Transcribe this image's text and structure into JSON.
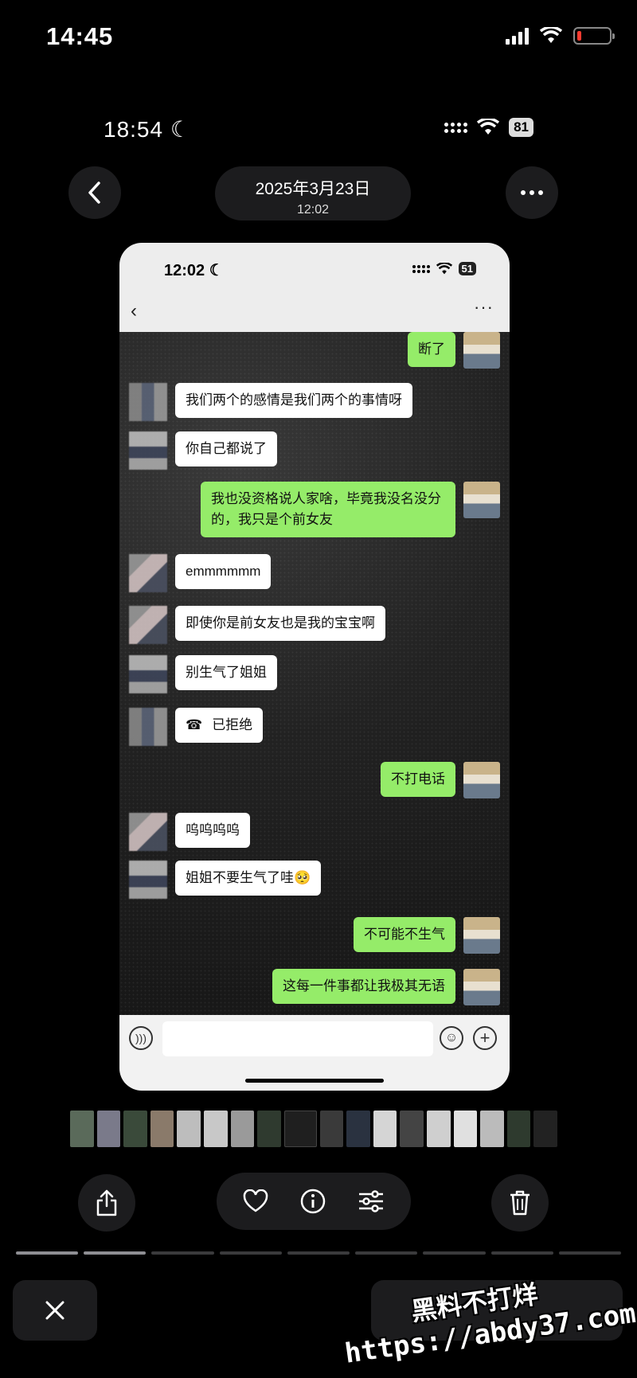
{
  "outer_status": {
    "time": "14:45"
  },
  "viewer": {
    "status_time": "18:54",
    "battery": "81",
    "date": "2025年3月23日",
    "time": "12:02"
  },
  "inner_screen": {
    "time": "12:02",
    "battery": "51",
    "back": "‹",
    "more": "···",
    "messages": [
      {
        "side": "right",
        "text": "断了"
      },
      {
        "side": "left",
        "text": "我们两个的感情是我们两个的事情呀"
      },
      {
        "side": "left",
        "text": "你自己都说了"
      },
      {
        "side": "right",
        "text": "我也没资格说人家啥，毕竟我没名没分的，我只是个前女友"
      },
      {
        "side": "left",
        "text": "emmmmmm"
      },
      {
        "side": "left",
        "text": "即使你是前女友也是我的宝宝啊"
      },
      {
        "side": "left",
        "text": "别生气了姐姐"
      },
      {
        "side": "left",
        "text": "已拒绝",
        "icon": "phone-declined-icon"
      },
      {
        "side": "right",
        "text": "不打电话"
      },
      {
        "side": "left",
        "text": "呜呜呜呜"
      },
      {
        "side": "left",
        "text": "姐姐不要生气了哇🥺"
      },
      {
        "side": "right",
        "text": "不可能不生气"
      },
      {
        "side": "right",
        "text": "这每一件事都让我极其无语"
      }
    ]
  },
  "watermark": {
    "line1": "黑料不打烊",
    "line2": "https://abdy37.com"
  },
  "colors": {
    "green_bubble": "#95ec69",
    "white_bubble": "#ffffff",
    "panel": "#1c1c1e"
  },
  "icons": [
    "back-chevron-icon",
    "more-icon",
    "share-icon",
    "heart-icon",
    "info-icon",
    "adjust-icon",
    "trash-icon",
    "close-icon"
  ]
}
